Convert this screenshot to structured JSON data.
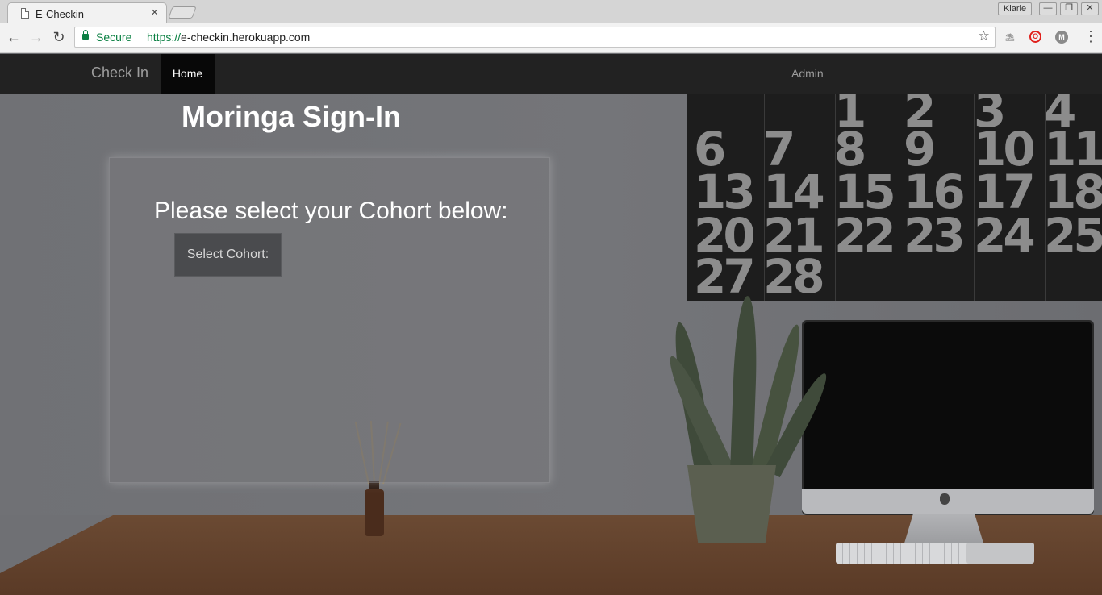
{
  "browser": {
    "tab_title": "E-Checkin",
    "tab_close": "×",
    "profile_name": "Kiarie",
    "back": "←",
    "forward": "→",
    "reload": "↻",
    "secure_label": "Secure",
    "url_scheme": "https://",
    "url_rest": "e-checkin.herokuapp.com",
    "bookmark_star": "☆",
    "menu": "⋮",
    "window_buttons": {
      "minimize": "—",
      "restore": "❐",
      "close": "✕"
    },
    "extensions": [
      {
        "name": "island-extension-icon",
        "glyph": "⛱",
        "color": "#9a9a9a"
      },
      {
        "name": "opera-extension-icon",
        "glyph": "O",
        "color": "#e0201c"
      },
      {
        "name": "m-extension-icon",
        "glyph": "M",
        "color": "#8a8a8a"
      }
    ]
  },
  "navbar": {
    "brand": "Check In",
    "home": "Home",
    "admin": "Admin"
  },
  "main": {
    "heading": "Moringa Sign-In",
    "prompt": "Please select your Cohort below:",
    "select_label": "Select Cohort:"
  },
  "calendar": {
    "rows": [
      [
        "",
        "",
        "1",
        "2",
        "3",
        "4"
      ],
      [
        "6",
        "7",
        "8",
        "9",
        "10",
        "11"
      ],
      [
        "13",
        "14",
        "15",
        "16",
        "17",
        "18"
      ],
      [
        "20",
        "21",
        "22",
        "23",
        "24",
        "25"
      ],
      [
        "27",
        "28",
        "",
        "",
        "",
        ""
      ]
    ]
  },
  "colors": {
    "navbar_bg": "#222222",
    "secure_green": "#0b8043",
    "text_white": "#ffffff"
  }
}
